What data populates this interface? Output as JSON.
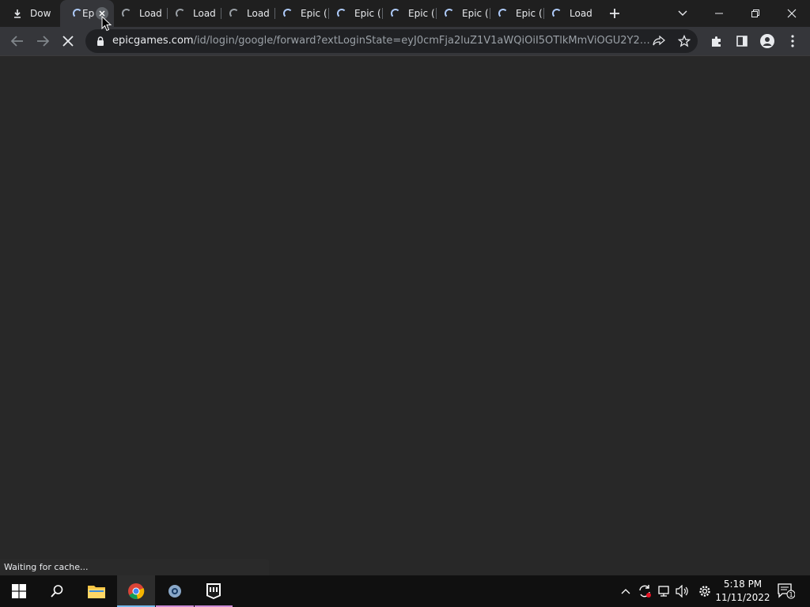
{
  "browser": {
    "tabs": [
      {
        "label": "Dow",
        "icon": "download-icon"
      },
      {
        "label": "Ep",
        "icon": "loading-spinner-icon"
      },
      {
        "label": "Load",
        "icon": "loading-spinner-icon"
      },
      {
        "label": "Load",
        "icon": "loading-spinner-icon"
      },
      {
        "label": "Load",
        "icon": "loading-spinner-icon"
      },
      {
        "label": "Epic (",
        "icon": "loading-spinner-icon"
      },
      {
        "label": "Epic (",
        "icon": "loading-spinner-icon"
      },
      {
        "label": "Epic (",
        "icon": "loading-spinner-icon"
      },
      {
        "label": "Epic (",
        "icon": "loading-spinner-icon"
      },
      {
        "label": "Epic (",
        "icon": "loading-spinner-icon"
      },
      {
        "label": "Load",
        "icon": "loading-spinner-icon"
      }
    ],
    "address_bar": {
      "host": "epicgames.com",
      "path": "/id/login/google/forward?extLoginState=eyJ0cmFja2luZ1V1aWQiOiI5OTlkMmViOGU2Y2M0..."
    },
    "status_text": "Waiting for cache..."
  },
  "taskbar": {
    "clock_time": "5:18 PM",
    "clock_date": "11/11/2022",
    "notification_count": "1"
  },
  "colors": {
    "tabstrip": "#1f1f1f",
    "toolbar": "#35363a",
    "page": "#282828",
    "taskbar": "#101010",
    "accent": "#aecbfa"
  }
}
